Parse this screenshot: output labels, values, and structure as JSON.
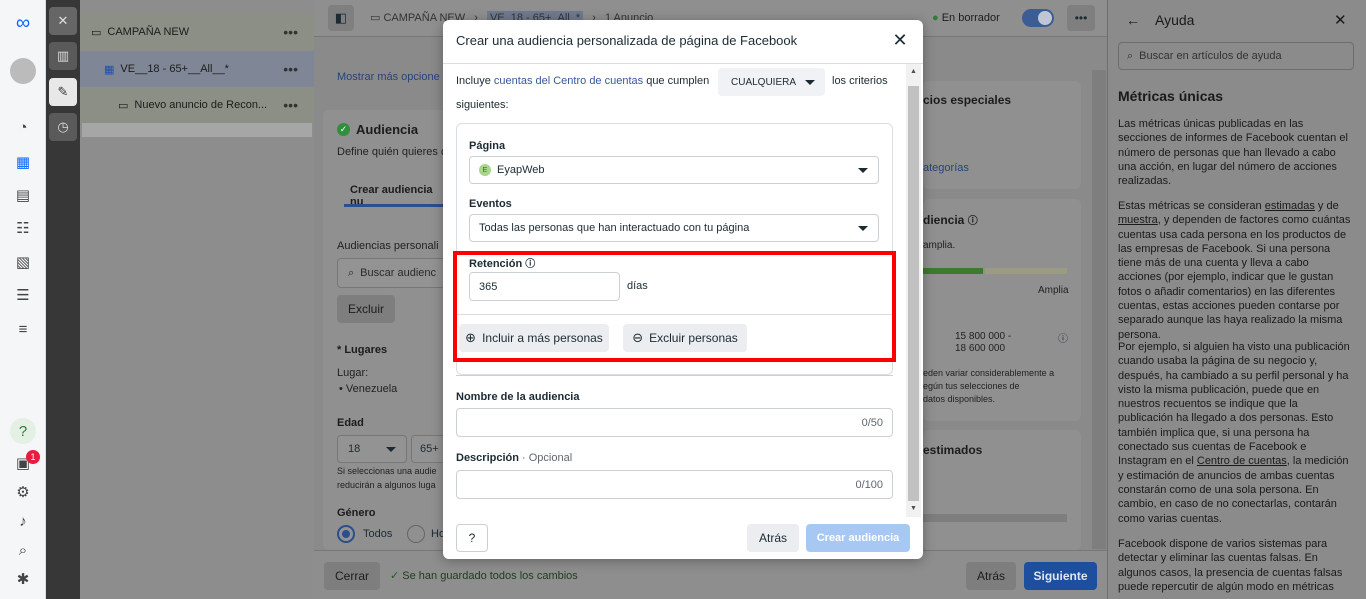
{
  "rail": {
    "notifications_badge": "1",
    "help_glyph": "?"
  },
  "tree": {
    "campaign": "CAMPAÑA NEW",
    "adset": "VE__18 - 65+__All__*",
    "ad": "Nuevo anuncio de Recon..."
  },
  "topbar": {
    "crumb_campaign": "CAMPAÑA NEW",
    "crumb_adset": "VE_18 - 65+_All_*",
    "crumb_ad": "1 Anuncio",
    "status": "En borrador"
  },
  "main": {
    "show_more": "Mostrar más opcione",
    "audience_title": "Audiencia",
    "audience_desc": "Define quién quieres c",
    "tab_create": "Crear audiencia nu",
    "custom_label": "Audiencias personali",
    "search_placeholder": "Buscar audienc",
    "exclude": "Excluir",
    "places_label": "* Lugares",
    "place_label": "Lugar:",
    "place_value": "Venezuela",
    "age_label": "Edad",
    "age_min": "18",
    "age_max": "65+",
    "age_note1": "Si seleccionas una audie",
    "age_note2": "reducirán a algunos luga",
    "gender_label": "Género",
    "gender_all": "Todos",
    "gender_h": "Ho",
    "special_title": "cios especiales",
    "categories_link": "ategorías",
    "audience_def_title": "diencia",
    "audience_def_sub": "amplia.",
    "amplia": "Amplia",
    "reach_value_1": "15 800 000 -",
    "reach_value_2": "18 600 000",
    "reach_note1": "eden variar considerablemente a",
    "reach_note2": "egún tus selecciones de",
    "reach_note3": "datos disponibles.",
    "estimated_title": "estimados"
  },
  "bottom": {
    "cancel": "Cerrar",
    "saved": "Se han guardado todos los cambios",
    "back": "Atrás",
    "next": "Siguiente"
  },
  "help": {
    "title": "Ayuda",
    "search_placeholder": "Buscar en artículos de ayuda",
    "heading": "Métricas únicas",
    "p1": "Las métricas únicas publicadas en las secciones de informes de Facebook cuentan el número de personas que han llevado a cabo una acción, en lugar del número de acciones realizadas.",
    "p2_a": "Estas métricas se consideran ",
    "p2_link1": "estimadas",
    "p2_b": " y de ",
    "p2_link2": "muestra",
    "p2_c": ", y dependen de factores como cuántas cuentas usa cada persona en los productos de las empresas de Facebook. Si una persona tiene más de una cuenta y lleva a cabo acciones (por ejemplo, indicar que le gustan fotos o añadir comentarios) en las diferentes cuentas, estas acciones pueden contarse por separado aunque las haya realizado la misma persona.",
    "p3_a": "Por ejemplo, si alguien ha visto una publicación cuando usaba la página de su negocio y, después, ha cambiado a su perfil personal y ha visto la misma publicación, puede que en nuestros recuentos se indique que la publicación ha llegado a dos personas. Esto también implica que, si una persona ha conectado sus cuentas de Facebook e Instagram en el ",
    "p3_link": "Centro de cuentas",
    "p3_b": ", la medición y estimación de anuncios de ambas cuentas constarán como de una sola persona. En cambio, en caso de no conectarlas, contarán como varias cuentas.",
    "p4": "Facebook dispone de varios sistemas para detectar y eliminar las cuentas falsas. En algunos casos, la presencia de cuentas falsas puede repercutir de algún modo en métricas"
  },
  "modal": {
    "title": "Crear una audiencia personalizada de página de Facebook",
    "include_prefix": "Incluye ",
    "include_link": "cuentas del Centro de cuentas",
    "include_mid": " que cumplen",
    "match_select": "CUALQUIERA",
    "include_suffix": "los criterios",
    "include_line2": "siguientes:",
    "page_label": "Página",
    "page_value": "EyapWeb",
    "page_avatar": "E",
    "events_label": "Eventos",
    "events_value": "Todas las personas que han interactuado con tu página",
    "retention_label": "Retención",
    "retention_value": "365",
    "retention_unit": "días",
    "include_more": "Incluir a más personas",
    "exclude_people": "Excluir personas",
    "name_label": "Nombre de la audiencia",
    "name_counter": "0/50",
    "desc_label": "Descripción",
    "desc_optional": "· Opcional",
    "desc_counter": "0/100",
    "back": "Atrás",
    "create": "Crear audiencia"
  },
  "colors": {
    "accent": "#1877f2",
    "highlight": "#ff0000",
    "success": "#42b72a"
  }
}
